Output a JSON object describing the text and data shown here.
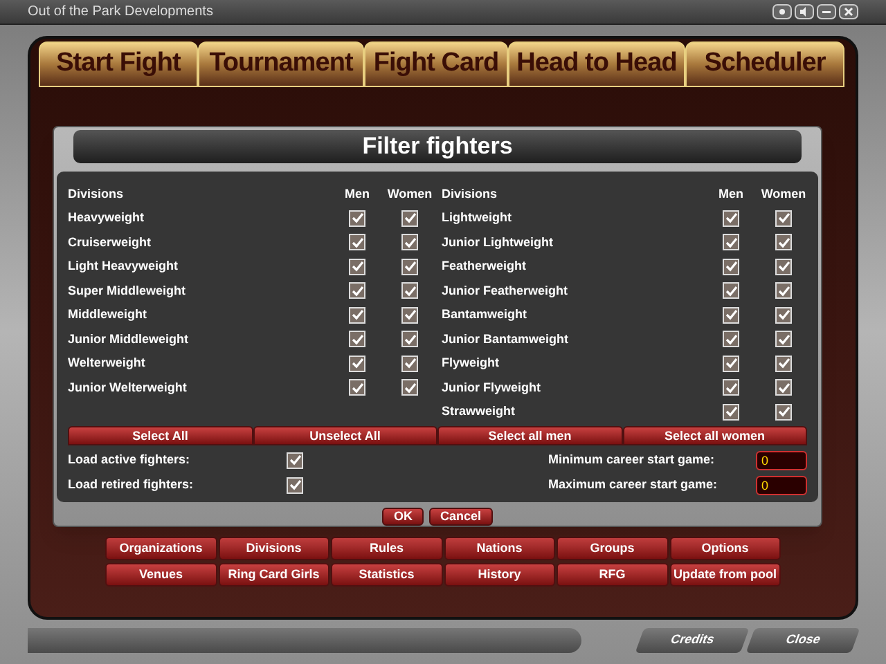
{
  "window": {
    "title": "Out of the Park Developments"
  },
  "tabs": [
    {
      "label": "Start Fight"
    },
    {
      "label": "Tournament"
    },
    {
      "label": "Fight Card"
    },
    {
      "label": "Head to Head"
    },
    {
      "label": "Scheduler"
    }
  ],
  "dialog": {
    "title": "Filter fighters",
    "tables": [
      {
        "headers": [
          "Divisions",
          "Men",
          "Women"
        ],
        "rows": [
          {
            "name": "Heavyweight",
            "men": true,
            "women": true
          },
          {
            "name": "Cruiserweight",
            "men": true,
            "women": true
          },
          {
            "name": "Light Heavyweight",
            "men": true,
            "women": true
          },
          {
            "name": "Super Middleweight",
            "men": true,
            "women": true
          },
          {
            "name": "Middleweight",
            "men": true,
            "women": true
          },
          {
            "name": "Junior Middleweight",
            "men": true,
            "women": true
          },
          {
            "name": "Welterweight",
            "men": true,
            "women": true
          },
          {
            "name": "Junior Welterweight",
            "men": true,
            "women": true
          }
        ]
      },
      {
        "headers": [
          "Divisions",
          "Men",
          "Women"
        ],
        "rows": [
          {
            "name": "Lightweight",
            "men": true,
            "women": true
          },
          {
            "name": "Junior Lightweight",
            "men": true,
            "women": true
          },
          {
            "name": "Featherweight",
            "men": true,
            "women": true
          },
          {
            "name": "Junior Featherweight",
            "men": true,
            "women": true
          },
          {
            "name": "Bantamweight",
            "men": true,
            "women": true
          },
          {
            "name": "Junior Bantamweight",
            "men": true,
            "women": true
          },
          {
            "name": "Flyweight",
            "men": true,
            "women": true
          },
          {
            "name": "Junior Flyweight",
            "men": true,
            "women": true
          },
          {
            "name": "Strawweight",
            "men": true,
            "women": true
          }
        ]
      }
    ],
    "select_buttons": [
      "Select All",
      "Unselect All",
      "Select all men",
      "Select all women"
    ],
    "options": [
      {
        "label": "Load active fighters:",
        "checked": true
      },
      {
        "label": "Load retired fighters:",
        "checked": true
      }
    ],
    "fields": [
      {
        "label": "Minimum career start game:",
        "value": "0"
      },
      {
        "label": "Maximum career start game:",
        "value": "0"
      }
    ],
    "buttons": [
      "OK",
      "Cancel"
    ]
  },
  "menu_buttons": [
    [
      "Organizations",
      "Divisions",
      "Rules",
      "Nations",
      "Groups",
      "Options"
    ],
    [
      "Venues",
      "Ring Card Girls",
      "Statistics",
      "History",
      "RFG",
      "Update from pool"
    ]
  ],
  "footer_buttons": [
    "Credits",
    "Close"
  ]
}
